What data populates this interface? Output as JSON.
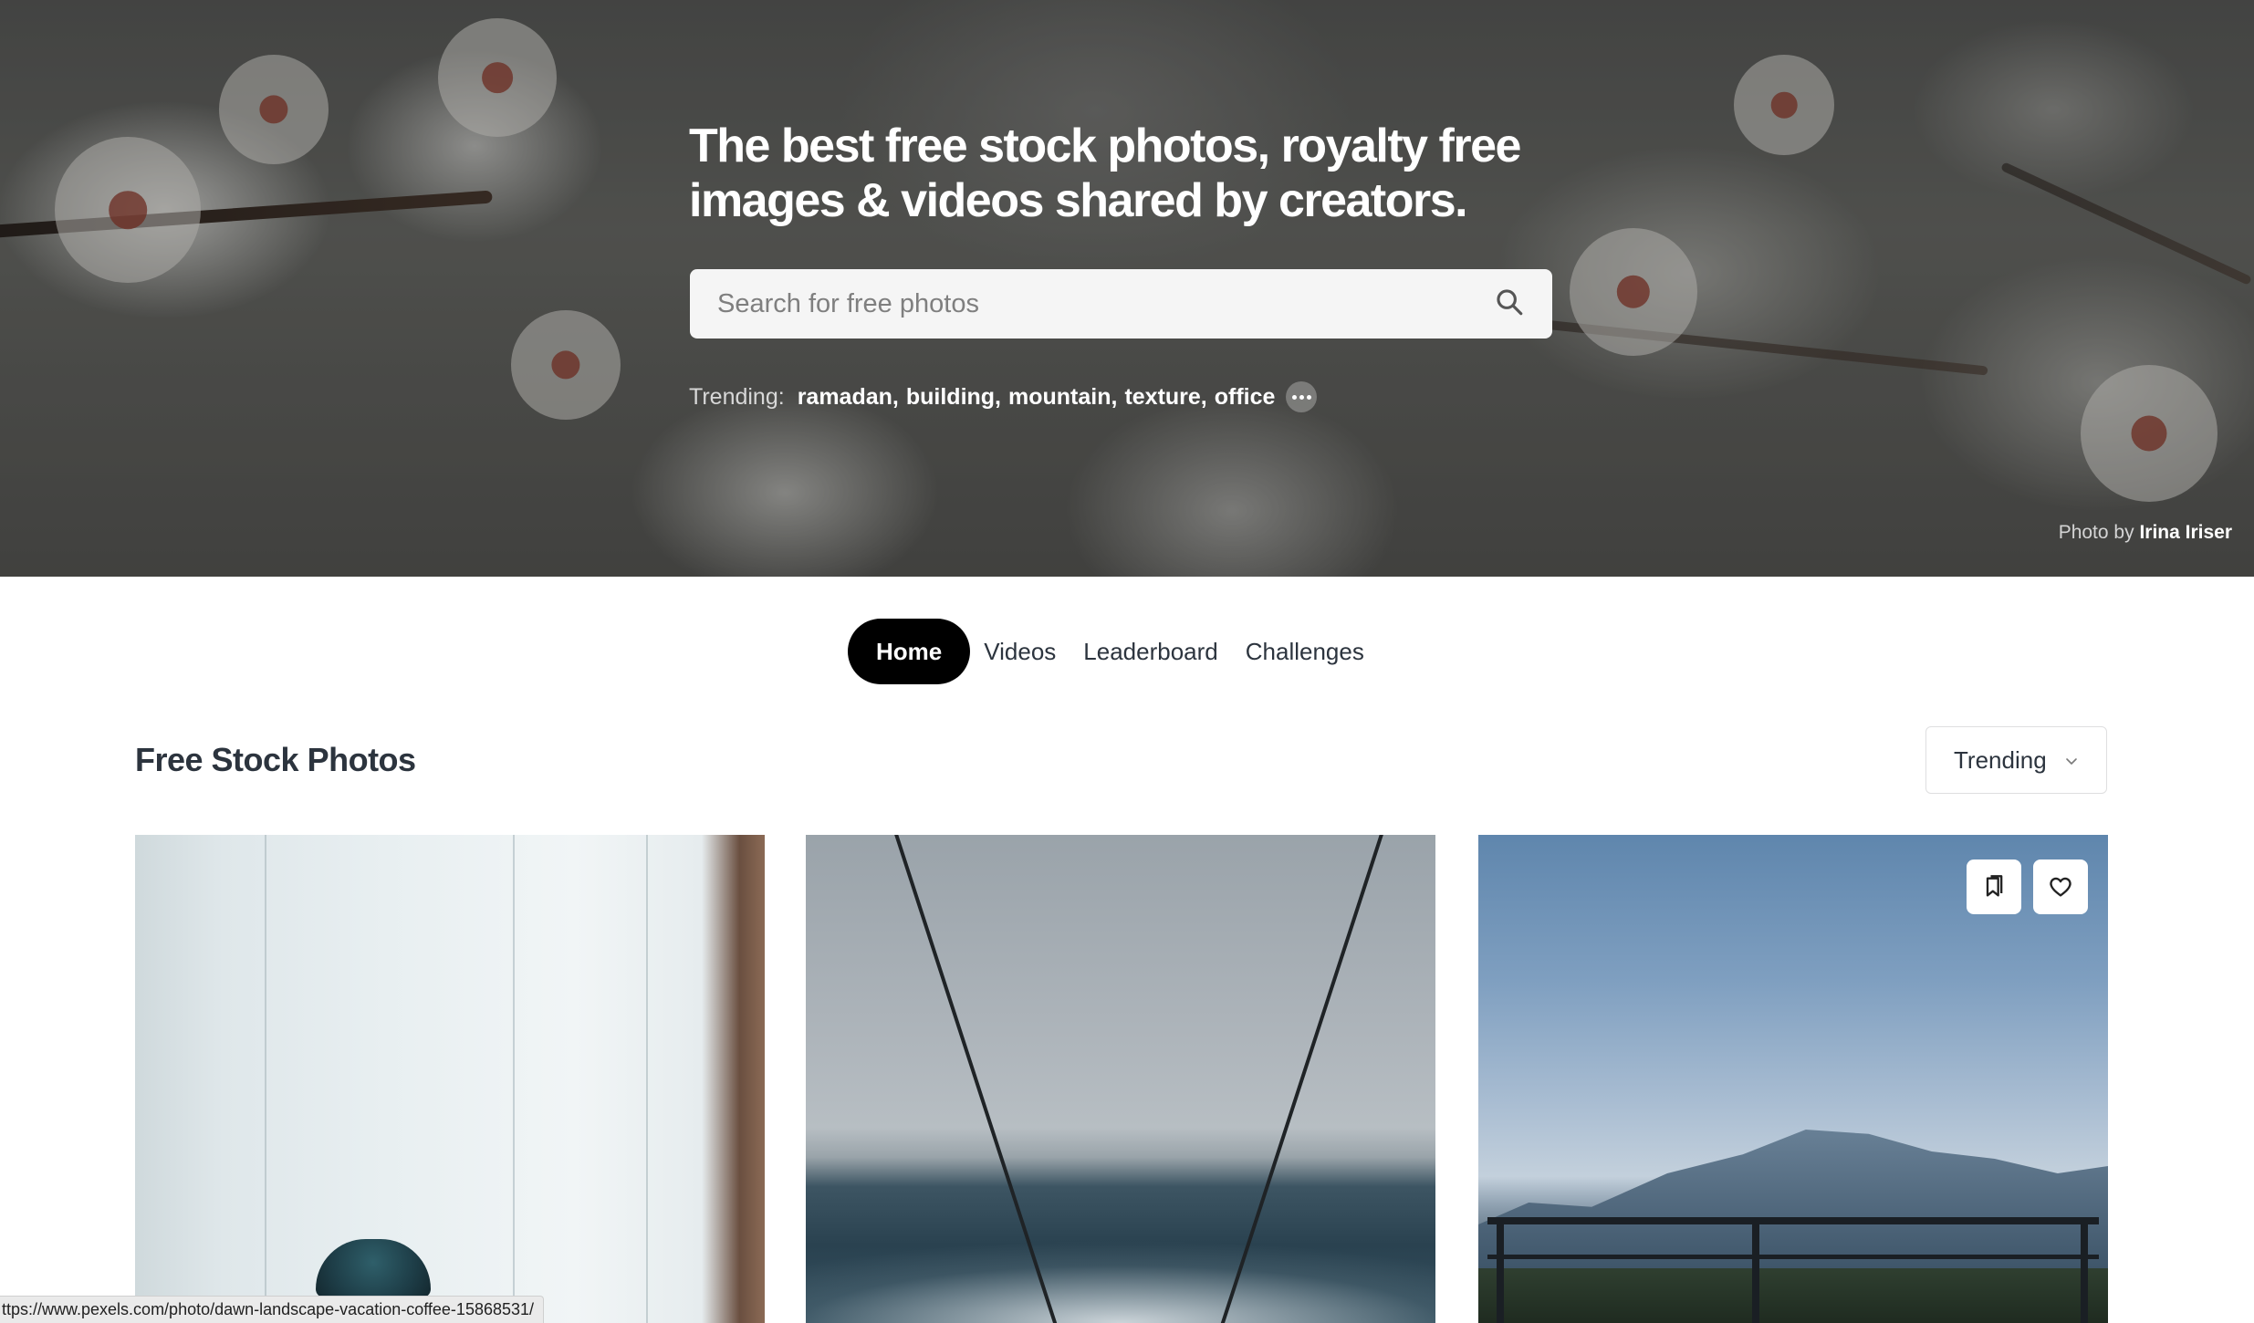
{
  "hero": {
    "title": "The best free stock photos, royalty free images & videos shared by creators.",
    "search_placeholder": "Search for free photos",
    "trending_label": "Trending:",
    "trending_tags": [
      "ramadan,",
      "building,",
      "mountain,",
      "texture,",
      "office"
    ],
    "credit_prefix": "Photo by",
    "credit_name": "Irina Iriser"
  },
  "tabs": [
    {
      "label": "Home",
      "active": true
    },
    {
      "label": "Videos",
      "active": false
    },
    {
      "label": "Leaderboard",
      "active": false
    },
    {
      "label": "Challenges",
      "active": false
    }
  ],
  "section": {
    "title": "Free Stock Photos",
    "sort_value": "Trending"
  },
  "status_bar": {
    "url": "ttps://www.pexels.com/photo/dawn-landscape-vacation-coffee-15868531/"
  },
  "colors": {
    "active_tab_bg": "#000000",
    "text": "#2c343e"
  },
  "icons": {
    "search": "search-icon",
    "more": "more-dots-icon",
    "sort": "chevron-down-icon",
    "collect": "bookmark-icon",
    "like": "heart-icon"
  }
}
